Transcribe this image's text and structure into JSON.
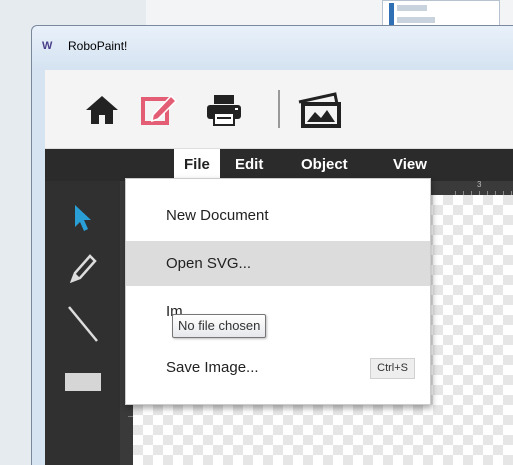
{
  "window": {
    "logo": "W",
    "title": "RoboPaint!"
  },
  "toolbar": {
    "icons": [
      "home-icon",
      "edit-icon",
      "print-icon",
      "image-icon"
    ],
    "active_color": "#e35d74"
  },
  "menubar": {
    "items": [
      {
        "label": "File",
        "active": true
      },
      {
        "label": "Edit"
      },
      {
        "label": "Object"
      },
      {
        "label": "View"
      }
    ]
  },
  "sidebar": {
    "tools": [
      "pointer-icon",
      "pencil-icon",
      "line-icon",
      "rectangle-icon"
    ],
    "pointer_color": "#2a9fd6"
  },
  "ruler": {
    "partial_number": "3"
  },
  "file_menu": {
    "items": [
      {
        "label": "New Document",
        "shortcut": ""
      },
      {
        "label": "Open SVG...",
        "shortcut": "",
        "hovered": true
      },
      {
        "label": "Im",
        "shortcut": ""
      },
      {
        "label": "Save Image...",
        "shortcut": "Ctrl+S"
      }
    ]
  },
  "tooltip": {
    "text": "No file chosen"
  }
}
